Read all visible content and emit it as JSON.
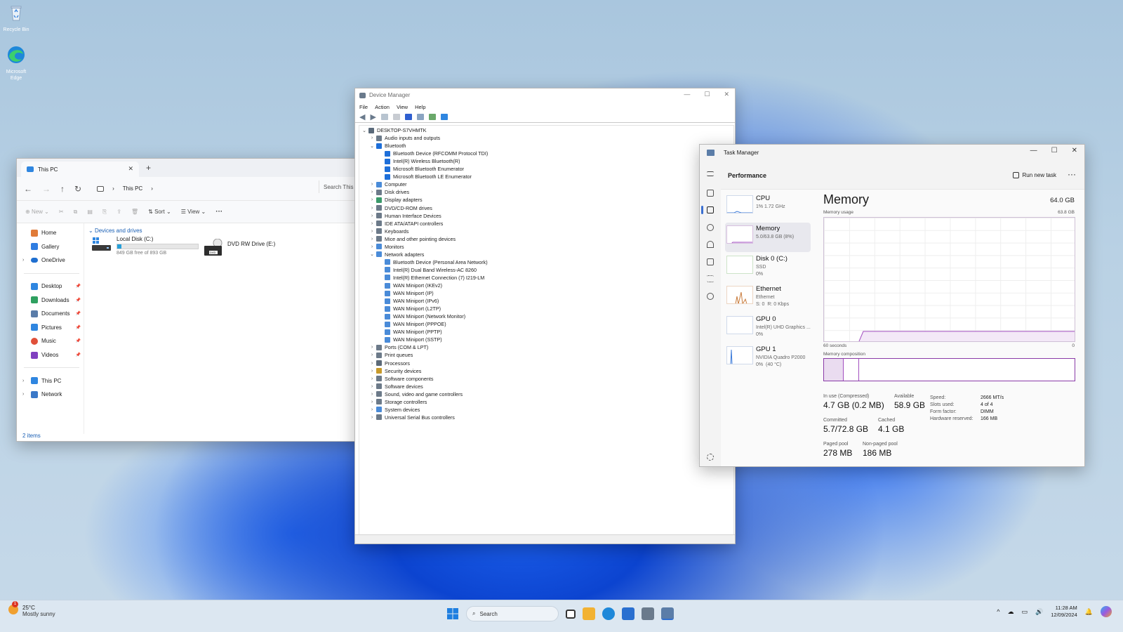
{
  "desktop": {
    "icons": [
      {
        "label": "Recycle Bin",
        "icon": "recycle-bin-icon"
      },
      {
        "label": "Microsoft Edge",
        "icon": "edge-icon"
      }
    ]
  },
  "explorer": {
    "tab_title": "This PC",
    "breadcrumb": [
      "This PC"
    ],
    "search_placeholder": "Search This",
    "toolbar": {
      "new": "New",
      "sort": "Sort",
      "view": "View",
      "more": "···"
    },
    "nav_items": [
      {
        "label": "Home",
        "icon": "home-icon",
        "color": "#e07b39",
        "pinned": false
      },
      {
        "label": "Gallery",
        "icon": "gallery-icon",
        "color": "#2f7de1",
        "pinned": false
      },
      {
        "label": "OneDrive",
        "icon": "cloud-icon",
        "color": "#1f6fd0",
        "pinned": false,
        "expandable": true
      }
    ],
    "quick_access": [
      {
        "label": "Desktop",
        "icon": "desktop-icon",
        "color": "#2f86e0"
      },
      {
        "label": "Downloads",
        "icon": "download-icon",
        "color": "#2fa060"
      },
      {
        "label": "Documents",
        "icon": "documents-icon",
        "color": "#5a7ca8"
      },
      {
        "label": "Pictures",
        "icon": "pictures-icon",
        "color": "#2f86e0"
      },
      {
        "label": "Music",
        "icon": "music-icon",
        "color": "#e0503a"
      },
      {
        "label": "Videos",
        "icon": "videos-icon",
        "color": "#8040c0"
      }
    ],
    "locations": [
      {
        "label": "This PC",
        "icon": "pc-icon",
        "color": "#2f86e0"
      },
      {
        "label": "Network",
        "icon": "network-icon",
        "color": "#3a78c8"
      }
    ],
    "group_label": "Devices and drives",
    "drives": [
      {
        "name": "Local Disk (C:)",
        "free_text": "849 GB free of 893 GB",
        "used_fraction": 0.05
      },
      {
        "name": "DVD RW Drive (E:)",
        "badge": "DVD"
      }
    ],
    "status": "2 items"
  },
  "devmgr": {
    "title": "Device Manager",
    "menu": [
      "File",
      "Action",
      "View",
      "Help"
    ],
    "root": "DESKTOP-S7VHMTK",
    "tree": [
      {
        "label": "Audio inputs and outputs",
        "level": 1,
        "state": "collapsed",
        "color": "#6c7a89"
      },
      {
        "label": "Bluetooth",
        "level": 1,
        "state": "expanded",
        "color": "#1e6fd9"
      },
      {
        "label": "Bluetooth Device (RFCOMM Protocol TDI)",
        "level": 2,
        "color": "#1e6fd9"
      },
      {
        "label": "Intel(R) Wireless Bluetooth(R)",
        "level": 2,
        "color": "#1e6fd9"
      },
      {
        "label": "Microsoft Bluetooth Enumerator",
        "level": 2,
        "color": "#1e6fd9"
      },
      {
        "label": "Microsoft Bluetooth LE Enumerator",
        "level": 2,
        "color": "#1e6fd9"
      },
      {
        "label": "Computer",
        "level": 1,
        "state": "collapsed",
        "color": "#4a8bd8"
      },
      {
        "label": "Disk drives",
        "level": 1,
        "state": "collapsed",
        "color": "#6c7a89"
      },
      {
        "label": "Display adapters",
        "level": 1,
        "state": "collapsed",
        "color": "#3a9a6a"
      },
      {
        "label": "DVD/CD-ROM drives",
        "level": 1,
        "state": "collapsed",
        "color": "#6c7a89"
      },
      {
        "label": "Human Interface Devices",
        "level": 1,
        "state": "collapsed",
        "color": "#6c7a89"
      },
      {
        "label": "IDE ATA/ATAPI controllers",
        "level": 1,
        "state": "collapsed",
        "color": "#6c7a89"
      },
      {
        "label": "Keyboards",
        "level": 1,
        "state": "collapsed",
        "color": "#6c7a89"
      },
      {
        "label": "Mice and other pointing devices",
        "level": 1,
        "state": "collapsed",
        "color": "#6c7a89"
      },
      {
        "label": "Monitors",
        "level": 1,
        "state": "collapsed",
        "color": "#4a8bd8"
      },
      {
        "label": "Network adapters",
        "level": 1,
        "state": "expanded",
        "color": "#4a8bd8"
      },
      {
        "label": "Bluetooth Device (Personal Area Network)",
        "level": 2,
        "color": "#4a8bd8"
      },
      {
        "label": "Intel(R) Dual Band Wireless-AC 8260",
        "level": 2,
        "color": "#4a8bd8"
      },
      {
        "label": "Intel(R) Ethernet Connection (7) I219-LM",
        "level": 2,
        "color": "#4a8bd8"
      },
      {
        "label": "WAN Miniport (IKEv2)",
        "level": 2,
        "color": "#4a8bd8"
      },
      {
        "label": "WAN Miniport (IP)",
        "level": 2,
        "color": "#4a8bd8"
      },
      {
        "label": "WAN Miniport (IPv6)",
        "level": 2,
        "color": "#4a8bd8"
      },
      {
        "label": "WAN Miniport (L2TP)",
        "level": 2,
        "color": "#4a8bd8"
      },
      {
        "label": "WAN Miniport (Network Monitor)",
        "level": 2,
        "color": "#4a8bd8"
      },
      {
        "label": "WAN Miniport (PPPOE)",
        "level": 2,
        "color": "#4a8bd8"
      },
      {
        "label": "WAN Miniport (PPTP)",
        "level": 2,
        "color": "#4a8bd8"
      },
      {
        "label": "WAN Miniport (SSTP)",
        "level": 2,
        "color": "#4a8bd8"
      },
      {
        "label": "Ports (COM & LPT)",
        "level": 1,
        "state": "collapsed",
        "color": "#6c7a89"
      },
      {
        "label": "Print queues",
        "level": 1,
        "state": "collapsed",
        "color": "#6c7a89"
      },
      {
        "label": "Processors",
        "level": 1,
        "state": "collapsed",
        "color": "#5c6a78"
      },
      {
        "label": "Security devices",
        "level": 1,
        "state": "collapsed",
        "color": "#c89a2a"
      },
      {
        "label": "Software components",
        "level": 1,
        "state": "collapsed",
        "color": "#6c7a89"
      },
      {
        "label": "Software devices",
        "level": 1,
        "state": "collapsed",
        "color": "#6c7a89"
      },
      {
        "label": "Sound, video and game controllers",
        "level": 1,
        "state": "collapsed",
        "color": "#6c7a89"
      },
      {
        "label": "Storage controllers",
        "level": 1,
        "state": "collapsed",
        "color": "#6c7a89"
      },
      {
        "label": "System devices",
        "level": 1,
        "state": "collapsed",
        "color": "#4a8bd8"
      },
      {
        "label": "Universal Serial Bus controllers",
        "level": 1,
        "state": "collapsed",
        "color": "#6c7a89"
      }
    ]
  },
  "taskmgr": {
    "title": "Task Manager",
    "page_title": "Performance",
    "run_new_task": "Run new task",
    "resources": [
      {
        "name": "CPU",
        "sub": "1%  1.72 GHz",
        "color": "#3b7ad9"
      },
      {
        "name": "Memory",
        "sub": "5.0/63.8 GB (8%)",
        "color": "#a24fc0",
        "active": true
      },
      {
        "name": "Disk 0 (C:)",
        "sub": "SSD\n0%",
        "color": "#4aa03a"
      },
      {
        "name": "Ethernet",
        "sub": "Ethernet\nS: 0  R: 0 Kbps",
        "color": "#c87a3a"
      },
      {
        "name": "GPU 0",
        "sub": "Intel(R) UHD Graphics ...\n0%",
        "color": "#3b7ad9"
      },
      {
        "name": "GPU 1",
        "sub": "NVIDIA Quadro P2000\n0%  (40 °C)",
        "color": "#3b7ad9"
      }
    ],
    "detail": {
      "title": "Memory",
      "capacity": "64.0 GB",
      "usage_label": "Memory usage",
      "max_label": "63.8 GB",
      "time_label": "60 seconds",
      "zero_label": "0",
      "composition_label": "Memory composition",
      "usage_percent": 8,
      "stats": [
        {
          "label": "In use (Compressed)",
          "value": "4.7 GB (0.2 MB)"
        },
        {
          "label": "Available",
          "value": "58.9 GB"
        },
        {
          "label": "Committed",
          "value": "5.7/72.8 GB"
        },
        {
          "label": "Cached",
          "value": "4.1 GB"
        },
        {
          "label": "Paged pool",
          "value": "278 MB"
        },
        {
          "label": "Non-paged pool",
          "value": "186 MB"
        }
      ],
      "specs": [
        {
          "k": "Speed:",
          "v": "2666 MT/s"
        },
        {
          "k": "Slots used:",
          "v": "4 of 4"
        },
        {
          "k": "Form factor:",
          "v": "DIMM"
        },
        {
          "k": "Hardware reserved:",
          "v": "166 MB"
        }
      ]
    }
  },
  "taskbar": {
    "weather_temp": "25°C",
    "weather_desc": "Mostly sunny",
    "weather_badge": "1",
    "search_label": "Search",
    "time": "11:28 AM",
    "date": "12/09/2024",
    "apps": [
      {
        "icon": "task-view-icon",
        "color": "#333"
      },
      {
        "icon": "file-explorer-icon",
        "color": "#f2b233"
      },
      {
        "icon": "edge-icon",
        "color": "#1e88d9"
      },
      {
        "icon": "store-icon",
        "color": "#2a6fd0"
      },
      {
        "icon": "device-manager-icon",
        "color": "#6a7a8c"
      },
      {
        "icon": "task-manager-icon",
        "color": "#5b7da8"
      }
    ]
  }
}
